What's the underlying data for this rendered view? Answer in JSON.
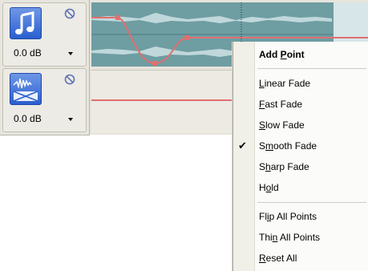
{
  "colors": {
    "clip_bg": "#6e9da2",
    "waveform": "#cfe3e5",
    "envelope": "#e07070",
    "track_icon": "#2a5fcf",
    "mute_icon": "#5f6fb3"
  },
  "tracks": [
    {
      "icon": "music-note-icon",
      "volume": "0.0 dB",
      "dropdown_icon": "chevron-down-icon",
      "mute_icon": "mute-icon"
    },
    {
      "icon": "audio-waveform-track-icon",
      "volume": "0.0 dB",
      "dropdown_icon": "chevron-down-icon",
      "mute_icon": "mute-icon"
    }
  ],
  "menu": {
    "add_point": {
      "pre": "Add ",
      "ul": "P",
      "post": "oint"
    },
    "linear_fade": {
      "pre": "",
      "ul": "L",
      "post": "inear Fade"
    },
    "fast_fade": {
      "pre": "",
      "ul": "F",
      "post": "ast Fade"
    },
    "slow_fade": {
      "pre": "",
      "ul": "S",
      "post": "low Fade"
    },
    "smooth_fade": {
      "pre": "S",
      "ul": "m",
      "post": "ooth Fade",
      "checked": true,
      "check_glyph": "✔"
    },
    "sharp_fade": {
      "pre": "S",
      "ul": "h",
      "post": "arp Fade"
    },
    "hold": {
      "pre": "H",
      "ul": "o",
      "post": "ld"
    },
    "flip_all_points": {
      "pre": "Fl",
      "ul": "i",
      "post": "p All Points"
    },
    "thin_all_points": {
      "pre": "Thi",
      "ul": "n",
      "post": " All Points"
    },
    "reset_all": {
      "pre": "",
      "ul": "R",
      "post": "eset All"
    }
  }
}
